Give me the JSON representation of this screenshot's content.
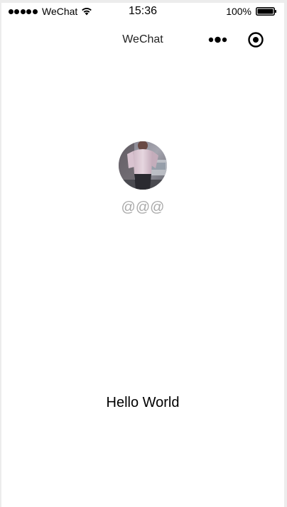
{
  "status_bar": {
    "carrier": "WeChat",
    "time": "15:36",
    "battery_percent": "100%",
    "signal_icon": "signal-dots-icon",
    "wifi_icon": "wifi-icon",
    "battery_icon": "battery-full-icon"
  },
  "nav_bar": {
    "title": "WeChat",
    "more_icon": "more-dots-icon",
    "close_icon": "target-circle-icon"
  },
  "profile": {
    "nickname": "@@@"
  },
  "main": {
    "motto": "Hello World"
  },
  "colors": {
    "background": "#ffffff",
    "frame": "#ececec",
    "nickname_text": "#aaaaaa",
    "text": "#000000"
  }
}
